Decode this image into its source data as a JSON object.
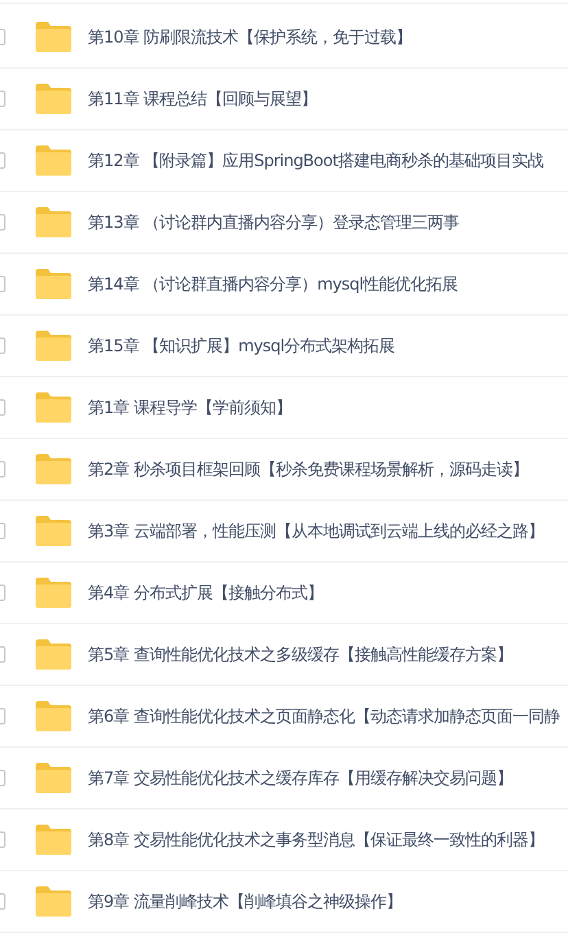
{
  "items": [
    {
      "title": "第10章 防刷限流技术【保护系统，免于过载】",
      "checked": false
    },
    {
      "title": "第11章 课程总结【回顾与展望】",
      "checked": false
    },
    {
      "title": "第12章 【附录篇】应用SpringBoot搭建电商秒杀的基础项目实战",
      "checked": false
    },
    {
      "title": "第13章 （讨论群内直播内容分享）登录态管理三两事",
      "checked": false
    },
    {
      "title": "第14章 （讨论群直播内容分享）mysql性能优化拓展",
      "checked": false
    },
    {
      "title": "第15章 【知识扩展】mysql分布式架构拓展",
      "checked": false
    },
    {
      "title": "第1章 课程导学【学前须知】",
      "checked": false
    },
    {
      "title": "第2章 秒杀项目框架回顾【秒杀免费课程场景解析，源码走读】",
      "checked": false
    },
    {
      "title": "第3章 云端部署，性能压测【从本地调试到云端上线的必经之路】",
      "checked": false
    },
    {
      "title": "第4章 分布式扩展【接触分布式】",
      "checked": false
    },
    {
      "title": "第5章 查询性能优化技术之多级缓存【接触高性能缓存方案】",
      "checked": false
    },
    {
      "title": "第6章 查询性能优化技术之页面静态化【动态请求加静态页面一同静",
      "checked": false
    },
    {
      "title": "第7章 交易性能优化技术之缓存库存【用缓存解决交易问题】",
      "checked": false
    },
    {
      "title": "第8章 交易性能优化技术之事务型消息【保证最终一致性的利器】",
      "checked": false
    },
    {
      "title": "第9章 流量削峰技术【削峰填谷之神级操作】",
      "checked": false
    }
  ]
}
